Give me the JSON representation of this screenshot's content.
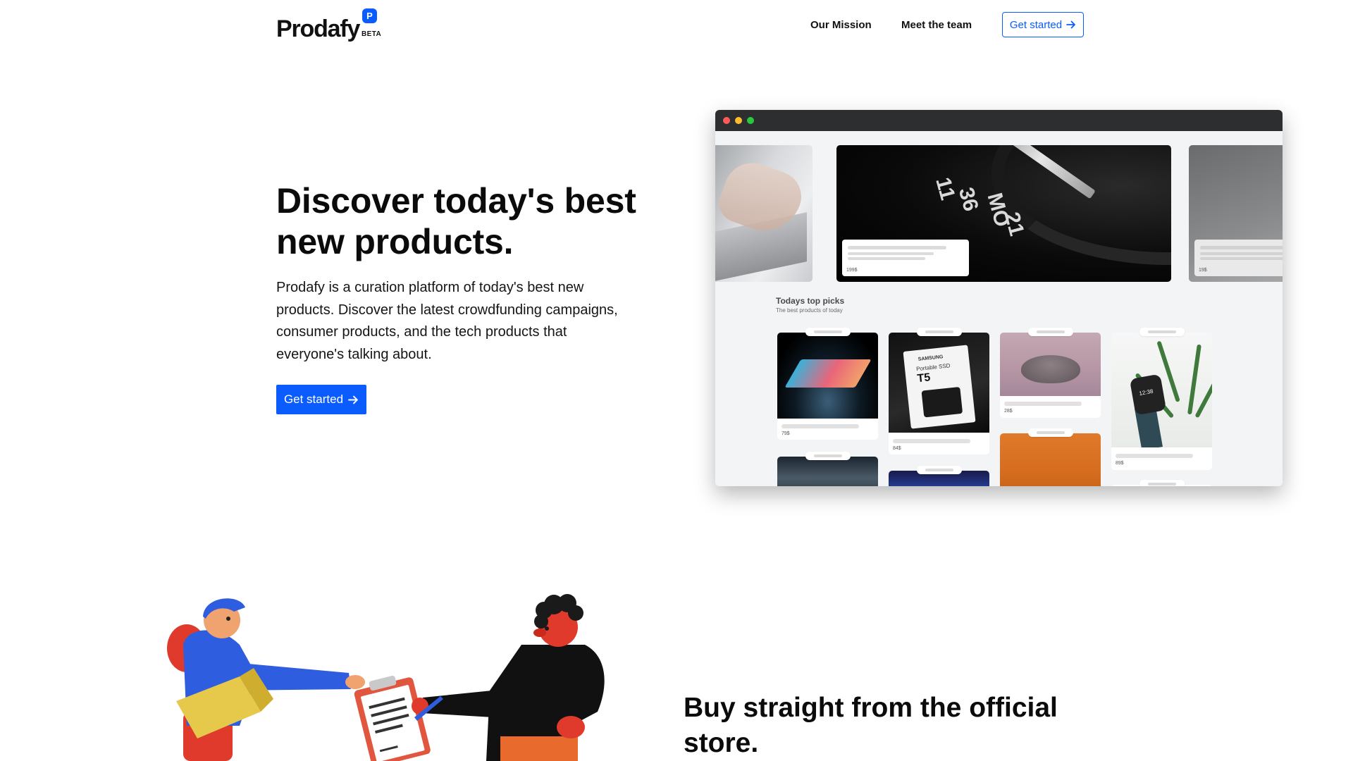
{
  "brand": {
    "name": "Prodafy",
    "badge": "P",
    "tag": "BETA",
    "accent_color": "#0b5cff"
  },
  "nav": {
    "links": [
      "Our Mission",
      "Meet the team"
    ],
    "cta_label": "Get started",
    "cta_icon": "arrow-right-icon"
  },
  "hero": {
    "title": "Discover today's best new products.",
    "description": "Prodafy is a curation platform of today's best new products. Discover the latest crowdfunding campaigns, consumer products, and the tech products that everyone's talking about.",
    "cta_label": "Get started",
    "cta_icon": "arrow-right-icon"
  },
  "mockup": {
    "window_dots": [
      "#ff5b56",
      "#ffbd2e",
      "#28c940"
    ],
    "carousel": {
      "center_watch_numbers": [
        "11",
        "36",
        "MO",
        "21"
      ],
      "center_price": "199$",
      "right_price": "19$"
    },
    "picks": {
      "title": "Todays  top picks",
      "subtitle": "The best products of today",
      "cards": [
        {
          "image": "laptop",
          "price": "79$"
        },
        {
          "image": "ssd",
          "brand": "SAMSUNG",
          "model": "Portable SSD",
          "name": "T5",
          "price": "84$"
        },
        {
          "image": "speaker",
          "price": "28$"
        },
        {
          "image": "smartwatch",
          "time": "12:38",
          "price": "89$"
        },
        {
          "image": "dark"
        },
        {
          "image": "blue"
        },
        {
          "image": "orange"
        }
      ]
    }
  },
  "section2": {
    "title": "Buy straight from the official store."
  }
}
